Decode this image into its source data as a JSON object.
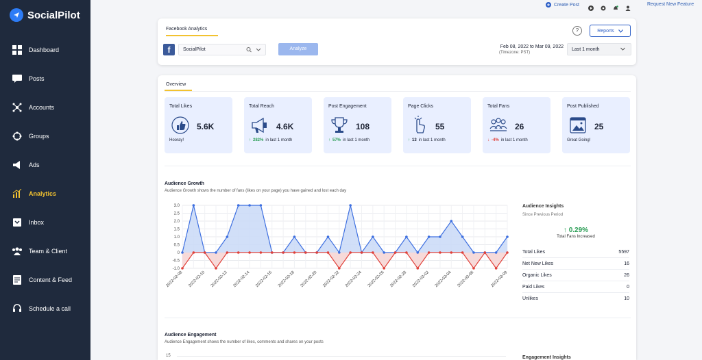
{
  "brand": {
    "name": "SocialPilot"
  },
  "sidebar": {
    "items": [
      {
        "label": "Dashboard",
        "icon": "dashboard-icon"
      },
      {
        "label": "Posts",
        "icon": "posts-icon"
      },
      {
        "label": "Accounts",
        "icon": "accounts-icon"
      },
      {
        "label": "Groups",
        "icon": "groups-icon"
      },
      {
        "label": "Ads",
        "icon": "megaphone-icon"
      },
      {
        "label": "Analytics",
        "icon": "analytics-icon",
        "active": true
      },
      {
        "label": "Inbox",
        "icon": "inbox-icon"
      },
      {
        "label": "Team & Client",
        "icon": "team-icon"
      },
      {
        "label": "Content & Feed",
        "icon": "content-icon"
      },
      {
        "label": "Schedule a call",
        "icon": "headset-icon"
      }
    ]
  },
  "topbar": {
    "create_post": "Create Post",
    "request_feature": "Request New Feature"
  },
  "header": {
    "tab": "Facebook Analytics",
    "reports_label": "Reports",
    "help": "?",
    "account": "SocialPilot",
    "analyze_label": "Analyze",
    "date_range": "Feb 08, 2022 to Mar 09, 2022",
    "timezone": "(Timezone: PST)",
    "period": "Last 1 month"
  },
  "overview": {
    "tab": "Overview",
    "stats": [
      {
        "title": "Total Likes",
        "value": "5.6K",
        "foot_text": "Hooray!",
        "icon": "thumbs-up-icon"
      },
      {
        "title": "Total Reach",
        "value": "4.6K",
        "foot_dir": "↑",
        "foot_pct": "282%",
        "foot_text": "in last 1 month",
        "icon": "megaphone-icon"
      },
      {
        "title": "Post Engagement",
        "value": "108",
        "foot_dir": "↑",
        "foot_pct": "57%",
        "foot_text": "in last 1 month",
        "icon": "trophy-icon"
      },
      {
        "title": "Page Clicks",
        "value": "55",
        "foot_dir": "↑",
        "foot_pct": "13",
        "foot_text": "in last 1 month",
        "icon": "pointer-icon"
      },
      {
        "title": "Total Fans",
        "value": "26",
        "foot_dir": "↓",
        "foot_pct": "-4%",
        "foot_text": "in last 1 month",
        "icon": "fans-icon"
      },
      {
        "title": "Post Published",
        "value": "25",
        "foot_text": "Great Going!",
        "icon": "image-post-icon"
      }
    ]
  },
  "audience_growth": {
    "title": "Audience Growth",
    "subtitle": "Audience Growth shows the number of fans (likes on your page) you have gained and lost each day"
  },
  "chart_data": {
    "type": "area",
    "x": [
      "2022-02-08",
      "2022-02-09",
      "2022-02-10",
      "2022-02-11",
      "2022-02-12",
      "2022-02-13",
      "2022-02-14",
      "2022-02-15",
      "2022-02-16",
      "2022-02-17",
      "2022-02-18",
      "2022-02-19",
      "2022-02-20",
      "2022-02-21",
      "2022-02-22",
      "2022-02-23",
      "2022-02-24",
      "2022-02-25",
      "2022-02-26",
      "2022-02-27",
      "2022-02-28",
      "2022-03-01",
      "2022-03-02",
      "2022-03-03",
      "2022-03-04",
      "2022-03-05",
      "2022-03-06",
      "2022-03-07",
      "2022-03-08",
      "2022-03-09"
    ],
    "xtick_labels": [
      "2022-02-08",
      "2022-02-10",
      "2022-02-12",
      "2022-02-14",
      "2022-02-16",
      "2022-02-18",
      "2022-02-20",
      "2022-02-22",
      "2022-02-24",
      "2022-02-26",
      "2022-02-28",
      "2022-03-02",
      "2022-03-04",
      "2022-03-06",
      "2022-03-09"
    ],
    "series": [
      {
        "values": [
          0,
          3,
          0,
          0,
          1,
          3,
          3,
          3,
          0,
          0,
          1,
          0,
          0,
          1,
          0,
          3,
          0,
          1,
          0,
          0,
          1,
          0,
          1,
          1,
          2,
          1,
          0,
          0,
          0,
          1
        ],
        "color": "#3d6fe0",
        "fill": "#c9d9f7"
      },
      {
        "values": [
          -1,
          0,
          0,
          -1,
          0,
          0,
          0,
          0,
          0,
          0,
          0,
          0,
          0,
          0,
          -1,
          0,
          0,
          0,
          -1,
          0,
          0,
          -1,
          0,
          0,
          0,
          0,
          -1,
          0,
          -1,
          0
        ],
        "color": "#e0413a",
        "fill": "#f6d3d2"
      }
    ],
    "yticks": [
      "3.0",
      "2.5",
      "2.0",
      "1.5",
      "1.0",
      "0.5",
      "0",
      "-0.5",
      "-1.0"
    ],
    "ylim": [
      -1,
      3
    ]
  },
  "insights": {
    "title": "Audience Insights",
    "subtitle": "Since Previous Period",
    "pct": "↑ 0.29%",
    "caption": "Total Fans Increased",
    "rows": [
      {
        "k": "Total Likes",
        "v": "5597"
      },
      {
        "k": "Net New Likes",
        "v": "16"
      },
      {
        "k": "Organic Likes",
        "v": "26"
      },
      {
        "k": "Paid Likes",
        "v": "0"
      },
      {
        "k": "Unlikes",
        "v": "10"
      }
    ]
  },
  "engagement": {
    "title": "Audience Engagement",
    "subtitle": "Audience Engagement shows the number of likes, comments and shares on your posts",
    "ytop": "15",
    "insights_title": "Engagement Insights"
  }
}
